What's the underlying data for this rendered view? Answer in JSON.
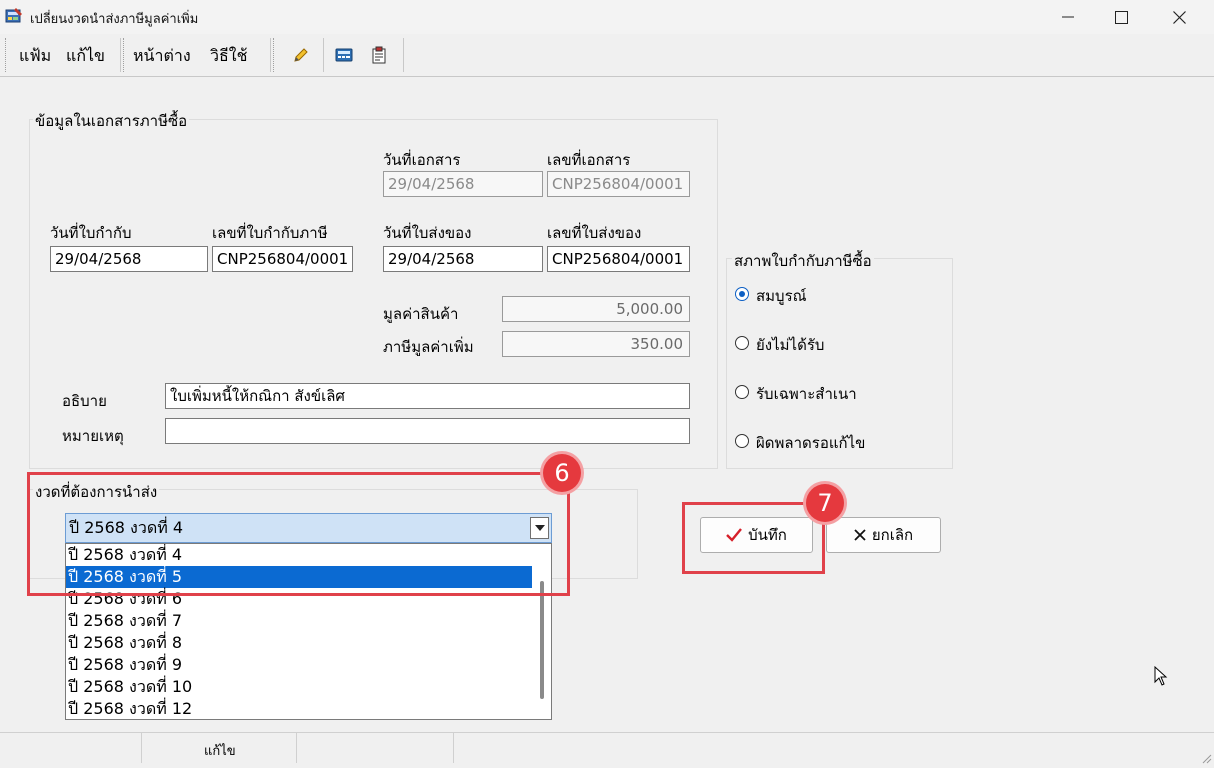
{
  "window": {
    "title": "เปลี่ยนงวดนำส่งภาษีมูลค่าเพิ่ม",
    "minimize_icon": "minimize-icon",
    "maximize_icon": "maximize-icon",
    "close_icon": "close-icon"
  },
  "menu": {
    "items": [
      "แฟ้ม",
      "แก้ไข",
      "หน้าต่าง",
      "วิธีใช้"
    ],
    "tools": [
      "pencil-icon",
      "calculator-icon",
      "clipboard-icon"
    ]
  },
  "doc_group": {
    "label": "ข้อมูลในเอกสารภาษีซื้อ",
    "doc_date_label": "วันที่เอกสาร",
    "doc_date": "29/04/2568",
    "doc_no_label": "เลขที่เอกสาร",
    "doc_no": "CNP256804/0001",
    "tax_inv_date_label": "วันที่ใบกำกับ",
    "tax_inv_date": "29/04/2568",
    "tax_inv_no_label": "เลขที่ใบกำกับภาษี",
    "tax_inv_no": "CNP256804/0001",
    "delivery_date_label": "วันที่ใบส่งของ",
    "delivery_date": "29/04/2568",
    "delivery_no_label": "เลขที่ใบส่งของ",
    "delivery_no": "CNP256804/0001",
    "goods_value_label": "มูลค่าสินค้า",
    "goods_value": "5,000.00",
    "vat_label": "ภาษีมูลค่าเพิ่ม",
    "vat": "350.00",
    "description_label": "อธิบาย",
    "description": "ใบเพิ่มหนี้ให้กณิกา  สังข์เลิศ",
    "remark_label": "หมายเหตุ",
    "remark": ""
  },
  "status_group": {
    "label": "สภาพใบกำกับภาษีซื้อ",
    "options": [
      "สมบูรณ์",
      "ยังไม่ได้รับ",
      "รับเฉพาะสำเนา",
      "ผิดพลาดรอแก้ไข"
    ],
    "selected_index": 0
  },
  "period_group": {
    "label": "งวดที่ต้องการนำส่ง",
    "selected": "ปี 2568 งวดที่ 4",
    "options": [
      "ปี 2568 งวดที่ 4",
      "ปี 2568 งวดที่ 5",
      "ปี 2568 งวดที่ 6",
      "ปี 2568 งวดที่ 7",
      "ปี 2568 งวดที่ 8",
      "ปี 2568 งวดที่ 9",
      "ปี 2568 งวดที่ 10",
      "ปี 2568 งวดที่ 12"
    ],
    "highlighted_index": 1
  },
  "buttons": {
    "save": "บันทึก",
    "cancel": "ยกเลิก"
  },
  "annotations": {
    "badge_1": "6",
    "badge_2": "7"
  },
  "statusbar": {
    "mode": "แก้ไข"
  },
  "colors": {
    "accent": "#0b6ad2",
    "annotation": "#e0414a",
    "combo_bg": "#cfe2f6"
  }
}
